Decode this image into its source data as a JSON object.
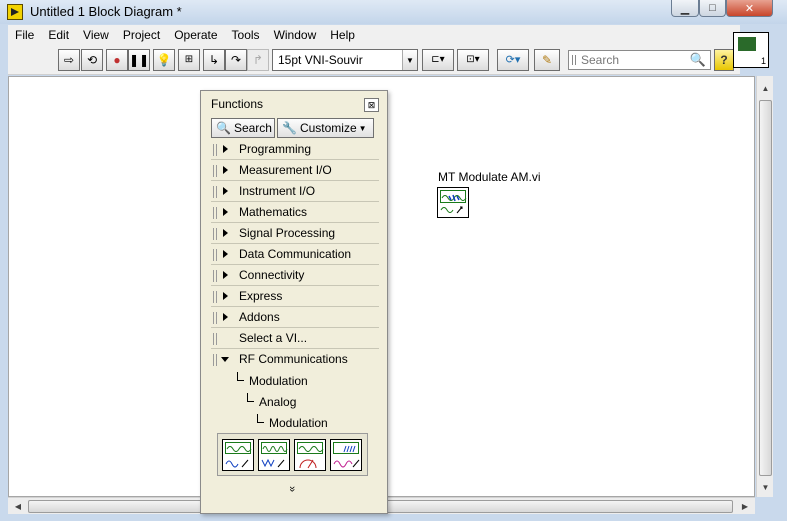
{
  "window": {
    "title": "Untitled 1 Block Diagram *",
    "minimize": "▁",
    "maximize": "□",
    "close": "✕"
  },
  "menu": [
    "File",
    "Edit",
    "View",
    "Project",
    "Operate",
    "Tools",
    "Window",
    "Help"
  ],
  "toolbar": {
    "font": "15pt VNI-Souvir",
    "search_placeholder": "Search",
    "help": "?"
  },
  "vi_icon_number": "1",
  "node": {
    "label": "MT Modulate AM.vi"
  },
  "palette": {
    "title": "Functions",
    "search_label": "Search",
    "customize_label": "Customize",
    "categories": [
      "Programming",
      "Measurement I/O",
      "Instrument I/O",
      "Mathematics",
      "Signal Processing",
      "Data Communication",
      "Connectivity",
      "Express",
      "Addons"
    ],
    "select_vi": "Select a VI...",
    "rf": "RF Communications",
    "path": [
      "Modulation",
      "Analog",
      "Modulation"
    ],
    "more": "»"
  }
}
